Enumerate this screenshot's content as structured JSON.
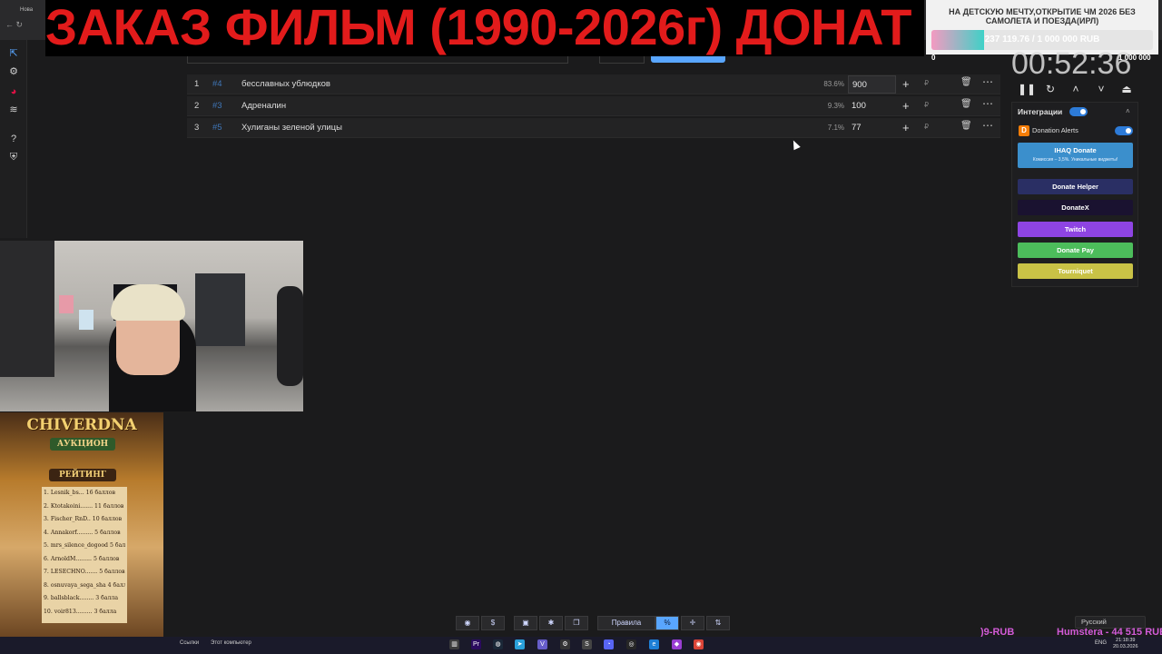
{
  "browser": {
    "tab_label": "Нова",
    "nav": "←  ↻"
  },
  "banner": {
    "text": "ЗАКАЗ ФИЛЬМ (1990-2026г) ДОНАТ"
  },
  "sidebar": {
    "icons": [
      "arrow-up-icon",
      "gear-icon",
      "pie-icon",
      "layers-icon",
      "help-icon",
      "shield-icon"
    ]
  },
  "lots": [
    {
      "index": "1",
      "id": "#4",
      "name": "бесславных ублюдков",
      "percent": "83.6%",
      "amount": "900",
      "currency": "₽"
    },
    {
      "index": "2",
      "id": "#3",
      "name": "Адреналин",
      "percent": "9.3%",
      "amount": "100",
      "currency": "₽"
    },
    {
      "index": "3",
      "id": "#5",
      "name": "Хулиганы зеленой улицы",
      "percent": "7.1%",
      "amount": "77",
      "currency": "₽"
    }
  ],
  "goal": {
    "title": "НА ДЕТСКУЮ МЕЧТУ,ОТКРЫТИЕ ЧМ 2026 БЕЗ САМОЛЕТА И ПОЕЗДА(ИРЛ)",
    "progress_text": "237 119.76 / 1 000 000 RUB",
    "progress_fraction": 0.237,
    "min": "0",
    "max": "1 000 000"
  },
  "timer": {
    "value": "00:52:36"
  },
  "integrations": {
    "title": "Интеграции",
    "donation_alerts": "Donation Alerts",
    "ihaq": "IHAQ Donate",
    "ihaq_sub": "Комиссия – 3,5%. Уникальные виджеты!",
    "donate_helper": "Donate Helper",
    "donatex": "DonateX",
    "twitch": "Twitch",
    "donate_pay": "Donate Pay",
    "tourniquet": "Tourniquet"
  },
  "auction": {
    "title": "CHIVERDNA",
    "subtitle": "АУКЦИОН",
    "rating_label": "РЕЙТИНГ",
    "rating": [
      "1. Lesnik_bs... 16 баллов",
      "2. Ktotakoini....... 11 баллов",
      "3. Fischer_RnD.. 10 баллов",
      "4. Annakorf......... 5 баллов",
      "5. mrs_silence_dogood 5 баллов",
      "6. ArnoldM......... 5 баллов",
      "7. LESECHNO....... 5 баллов",
      "8. osnuvaya_sega_sha 4 баллов",
      "9. ballsblack........ 3 балла",
      "10. voir813......... 3 балла"
    ]
  },
  "bottom_toolbar": {
    "rules_label": "Правила",
    "percent_label": "%"
  },
  "language": {
    "selected": "Русский"
  },
  "taskbar": {
    "links": "Ссылки",
    "this_pc": "Этот компьютер",
    "lang": "ENG",
    "time": "21:18:39",
    "date": "20.03.2026"
  },
  "ticker": {
    "part1": ")9-RUB",
    "part2": "Humstera - 44 515 RUB"
  },
  "colors": {
    "accent": "#59a6ff",
    "banner_red": "#e21b1b",
    "twitch": "#8e44e3",
    "donate_pay": "#4cbd5b",
    "tourniquet": "#c9c246",
    "donatex": "#1a1230",
    "donate_helper": "#2a2f64"
  }
}
